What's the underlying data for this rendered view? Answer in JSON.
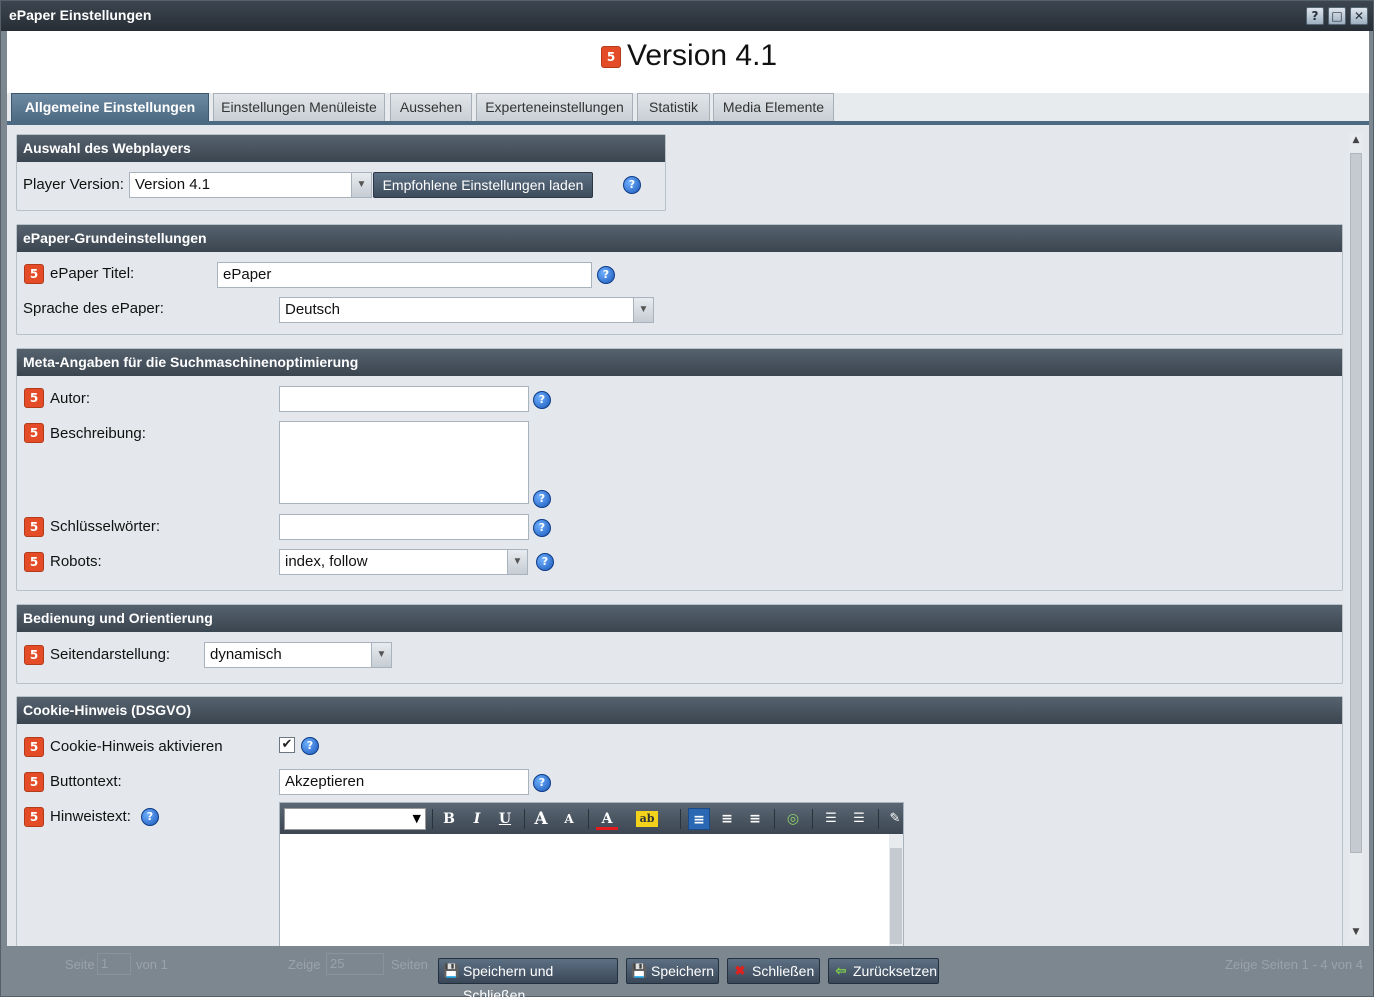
{
  "window": {
    "title": "ePaper Einstellungen"
  },
  "header": {
    "version": "Version 4.1"
  },
  "tabs": [
    {
      "label": "Allgemeine Einstellungen"
    },
    {
      "label": "Einstellungen Menüleiste"
    },
    {
      "label": "Aussehen"
    },
    {
      "label": "Experteneinstellungen"
    },
    {
      "label": "Statistik"
    },
    {
      "label": "Media Elemente"
    }
  ],
  "webplayer": {
    "title": "Auswahl des Webplayers",
    "player_label": "Player Version:",
    "player_value": "Version 4.1",
    "load_button": "Empfohlene Einstellungen laden"
  },
  "basic": {
    "title": "ePaper-Grundeinstellungen",
    "title_label": "ePaper Titel:",
    "title_value": "ePaper",
    "lang_label": "Sprache des ePaper:",
    "lang_value": "Deutsch"
  },
  "meta": {
    "title": "Meta-Angaben für die Suchmaschinenoptimierung",
    "author_label": "Autor:",
    "author_value": "",
    "desc_label": "Beschreibung:",
    "desc_value": "",
    "keywords_label": "Schlüsselwörter:",
    "keywords_value": "",
    "robots_label": "Robots:",
    "robots_value": "index, follow"
  },
  "navigation": {
    "title": "Bedienung und Orientierung",
    "page_label": "Seitendarstellung:",
    "page_value": "dynamisch"
  },
  "cookie": {
    "title": "Cookie-Hinweis (DSGVO)",
    "enable_label": "Cookie-Hinweis aktivieren",
    "enabled": true,
    "button_label": "Buttontext:",
    "button_value": "Akzeptieren",
    "hint_label": "Hinweistext:"
  },
  "icons": {
    "html5": "5",
    "help": "?",
    "dropdown": "▼",
    "check": "✔"
  },
  "footer": {
    "page_label": "Seite",
    "page_value": "1",
    "of_label": "von 1",
    "show_label": "Zeige",
    "show_value": "25",
    "pages_label": "Seiten",
    "info": "Zeige Seiten 1 - 4 von 4",
    "save_close": "Speichern und Schließen",
    "save": "Speichern",
    "close": "Schließen",
    "reset": "Zurücksetzen"
  },
  "colors": {
    "accent": "#4d6a83",
    "html5": "#e34c26",
    "header": "#3a4550"
  }
}
